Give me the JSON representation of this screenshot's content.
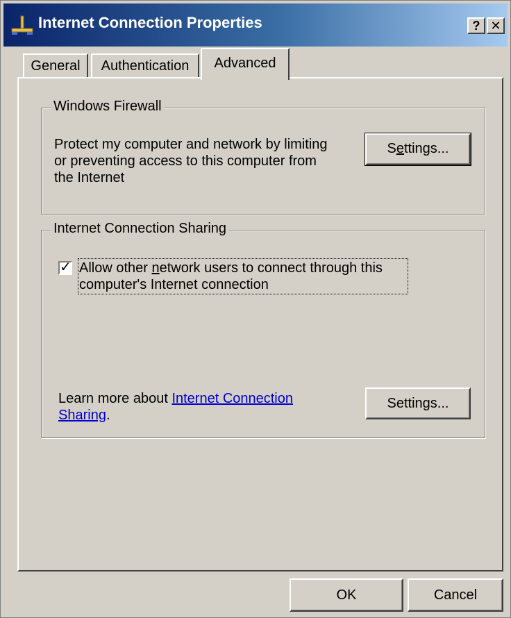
{
  "window": {
    "title": "Internet Connection Properties",
    "help_button": "?",
    "close_button": "✕"
  },
  "tabs": [
    {
      "label": "General",
      "active": false
    },
    {
      "label": "Authentication",
      "active": false
    },
    {
      "label": "Advanced",
      "active": true
    }
  ],
  "firewall": {
    "legend": "Windows Firewall",
    "description": [
      "Protect my computer and network by limiting",
      "or preventing access to this computer from",
      "the Internet"
    ],
    "settings_button": {
      "pre": "S",
      "accel": "e",
      "post": "ttings..."
    }
  },
  "ics": {
    "legend": "Internet Connection Sharing",
    "allow_checkbox": {
      "checked": true,
      "check_glyph": "✓",
      "line1_pre": "Allow other ",
      "line1_accel": "n",
      "line1_post": "etwork users to connect through this",
      "line2": "computer's Internet connection"
    },
    "learn_more_prefix": "Learn more about ",
    "learn_more_link_line1": "Internet Connection",
    "learn_more_link_line2": "Sharing",
    "learn_more_suffix": ".",
    "settings_button": "Settings..."
  },
  "footer": {
    "ok_label": "OK",
    "cancel_label": "Cancel"
  },
  "colors": {
    "titlebar_start": "#0a246a",
    "titlebar_end": "#a6caf0",
    "face": "#d4d0c8",
    "link": "#0000cc"
  }
}
